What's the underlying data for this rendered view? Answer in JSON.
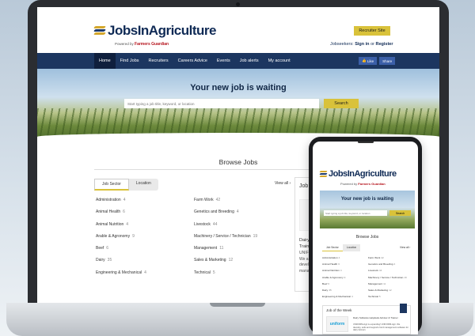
{
  "brand": {
    "name_a": "Jobs",
    "name_b": "In",
    "name_c": "Agriculture",
    "powered_by": "Powered by",
    "partner": "Farmers Guardian"
  },
  "header": {
    "recruiter_button": "Recruiter Site",
    "jobseekers": "Jobseekers:",
    "sign_in": "Sign in",
    "or": "or",
    "register": "Register"
  },
  "nav": {
    "items": [
      "Home",
      "Find Jobs",
      "Recruiters",
      "Careers Advice",
      "Events",
      "Job alerts",
      "My account"
    ],
    "like": "Like",
    "share": "Share"
  },
  "hero": {
    "title": "Your new job is waiting",
    "search_placeholder": "Start typing a job title, keyword, or location",
    "search_button": "Search"
  },
  "browse": {
    "title": "Browse Jobs",
    "tab_sector": "Job Sector",
    "tab_location": "Location",
    "view_all": "View all ›"
  },
  "sectors_left": [
    {
      "name": "Administration",
      "count": "4"
    },
    {
      "name": "Animal Health",
      "count": "6"
    },
    {
      "name": "Animal Nutrition",
      "count": "4"
    },
    {
      "name": "Arable & Agronomy",
      "count": "9"
    },
    {
      "name": "Beef",
      "count": "6"
    },
    {
      "name": "Dairy",
      "count": "35"
    },
    {
      "name": "Engineering & Mechanical",
      "count": "4"
    }
  ],
  "sectors_right": [
    {
      "name": "Farm Work",
      "count": "42"
    },
    {
      "name": "Genetics and Breeding",
      "count": "4"
    },
    {
      "name": "Livestock",
      "count": "44"
    },
    {
      "name": "Machinery / Service / Technician",
      "count": "19"
    },
    {
      "name": "Management",
      "count": "11"
    },
    {
      "name": "Sales & Marketing",
      "count": "12"
    },
    {
      "name": "Technical",
      "count": "5"
    }
  ],
  "job_card": {
    "heading": "Job",
    "title_l1": "Dairy",
    "title_l2": "Traini",
    "desc_l1": "UNIFOR",
    "desc_l2": "We ar",
    "desc_l3": "develo",
    "desc_l4": "manag"
  },
  "phone": {
    "job_heading": "Job of the Week",
    "logo_text": "uniform",
    "job_title": "Dairy Software Helpdesk Advisor & Trainer",
    "job_desc": "UNIFORM-Agri is expanding! UNIFORM-Agri. We develop, sells and supports herd management software for dairy farmers"
  }
}
